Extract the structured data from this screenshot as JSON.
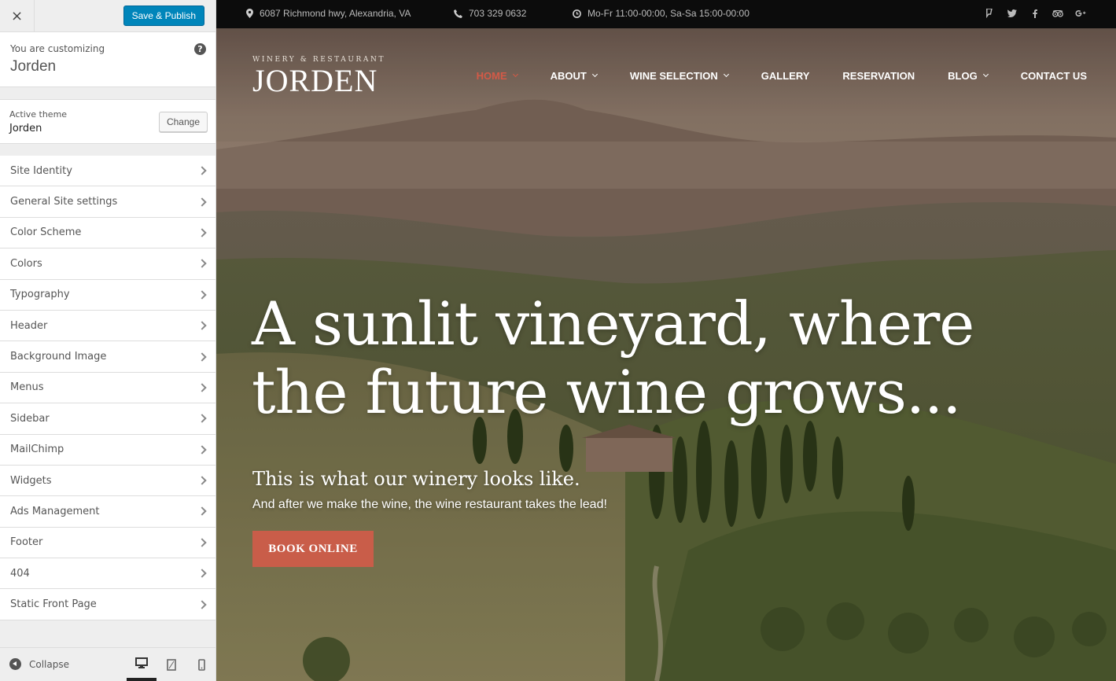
{
  "customizer": {
    "close_label": "×",
    "publish_label": "Save & Publish",
    "customizing_label": "You are customizing",
    "site_name": "Jorden",
    "help_label": "?",
    "active_theme_label": "Active theme",
    "active_theme_name": "Jorden",
    "change_label": "Change",
    "panels": [
      "Site Identity",
      "General Site settings",
      "Color Scheme",
      "Colors",
      "Typography",
      "Header",
      "Background Image",
      "Menus",
      "Sidebar",
      "MailChimp",
      "Widgets",
      "Ads Management",
      "Footer",
      "404",
      "Static Front Page"
    ],
    "collapse_label": "Collapse",
    "preview_devices": [
      "desktop-icon",
      "tablet-icon",
      "mobile-icon"
    ],
    "active_device": "desktop"
  },
  "topbar": {
    "address": "6087 Richmond hwy, Alexandria, VA",
    "phone": "703 329 0632",
    "hours": "Mo-Fr 11:00-00:00, Sa-Sa 15:00-00:00",
    "social_icons": [
      "foursquare-icon",
      "twitter-icon",
      "facebook-icon",
      "tripadvisor-icon",
      "google-plus-icon"
    ]
  },
  "logo": {
    "subtitle": "WINERY & RESTAURANT",
    "name": "JORDEN"
  },
  "nav": {
    "items": [
      {
        "label": "HOME",
        "has_caret": true,
        "active": true
      },
      {
        "label": "ABOUT",
        "has_caret": true,
        "active": false
      },
      {
        "label": "WINE SELECTION",
        "has_caret": true,
        "active": false
      },
      {
        "label": "GALLERY",
        "has_caret": false,
        "active": false
      },
      {
        "label": "RESERVATION",
        "has_caret": false,
        "active": false
      },
      {
        "label": "BLOG",
        "has_caret": true,
        "active": false
      },
      {
        "label": "CONTACT US",
        "has_caret": false,
        "active": false
      }
    ]
  },
  "hero": {
    "title": "A sunlit vineyard, where the future wine grows...",
    "subtitle": "This is what our winery looks like.",
    "description": "And after we make the wine, the wine restaurant takes the lead!",
    "cta_label": "BOOK ONLINE"
  },
  "colors": {
    "publish_button": "#0085ba",
    "nav_active": "#d35a47",
    "cta_button": "#c95d49",
    "topbar_bg": "#0c0c0c"
  }
}
